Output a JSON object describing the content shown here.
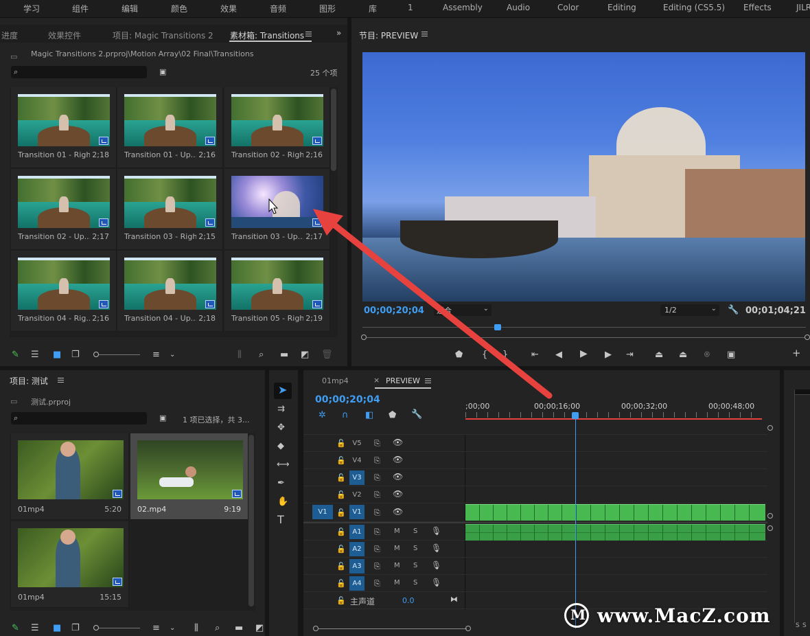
{
  "workspace_tabs": [
    "学习",
    "组件",
    "编辑",
    "颜色",
    "效果",
    "音频",
    "图形",
    "库",
    "1",
    "Assembly",
    "Audio",
    "Color",
    "Editing",
    "Editing (CS5.5)",
    "Effects",
    "JILR"
  ],
  "source_panel": {
    "tabs": [
      "进度",
      "效果控件",
      "项目: Magic Transitions 2",
      "素材箱: Transitions"
    ],
    "path": "Magic Transitions 2.prproj\\Motion Array\\02 Final\\Transitions",
    "count": "25 个项",
    "items": [
      {
        "name": "Transition 01 - Right...",
        "dur": "2;18"
      },
      {
        "name": "Transition 01 - Up...",
        "dur": "2;16"
      },
      {
        "name": "Transition 02 - Righ...",
        "dur": "2;16"
      },
      {
        "name": "Transition 02 - Up...",
        "dur": "2;17"
      },
      {
        "name": "Transition 03 - Righ...",
        "dur": "2;15"
      },
      {
        "name": "Transition 03 - Up...",
        "dur": "2;17"
      },
      {
        "name": "Transition 04 - Rig...",
        "dur": "2;16"
      },
      {
        "name": "Transition 04 - Up...",
        "dur": "2;18"
      },
      {
        "name": "Transition 05 - Righ...",
        "dur": "2;19"
      }
    ]
  },
  "program": {
    "title": "节目: PREVIEW",
    "timecode": "00;00;20;04",
    "fit": "适合",
    "quality": "1/2",
    "duration": "00;01;04;21"
  },
  "project_panel": {
    "title": "项目: 测试",
    "file": "测试.prproj",
    "selection": "1 项已选择，共 3...",
    "items": [
      {
        "name": "01mp4",
        "dur": "5:20"
      },
      {
        "name": "02.mp4",
        "dur": "9:19"
      },
      {
        "name": "01mp4",
        "dur": "15:15"
      }
    ]
  },
  "timeline": {
    "tabs": [
      "01mp4",
      "PREVIEW"
    ],
    "close_glyph": "×",
    "timecode": "00;00;20;04",
    "ruler": [
      ";00;00",
      "00;00;16;00",
      "00;00;32;00",
      "00;00;48;00"
    ],
    "video_tracks": [
      "V5",
      "V4",
      "V3",
      "V2",
      "V1"
    ],
    "audio_tracks": [
      "A1",
      "A2",
      "A3",
      "A4"
    ],
    "source_patch": "V1",
    "mute_label": "M",
    "solo_label": "S",
    "master_label": "主声道",
    "master_value": "0.0"
  },
  "watermark": "www.MacZ.com",
  "colors": {
    "accent": "#3f9ef3",
    "track_on": "#1d5d93",
    "clip_green": "#48b851",
    "arrow": "#e8423f"
  }
}
